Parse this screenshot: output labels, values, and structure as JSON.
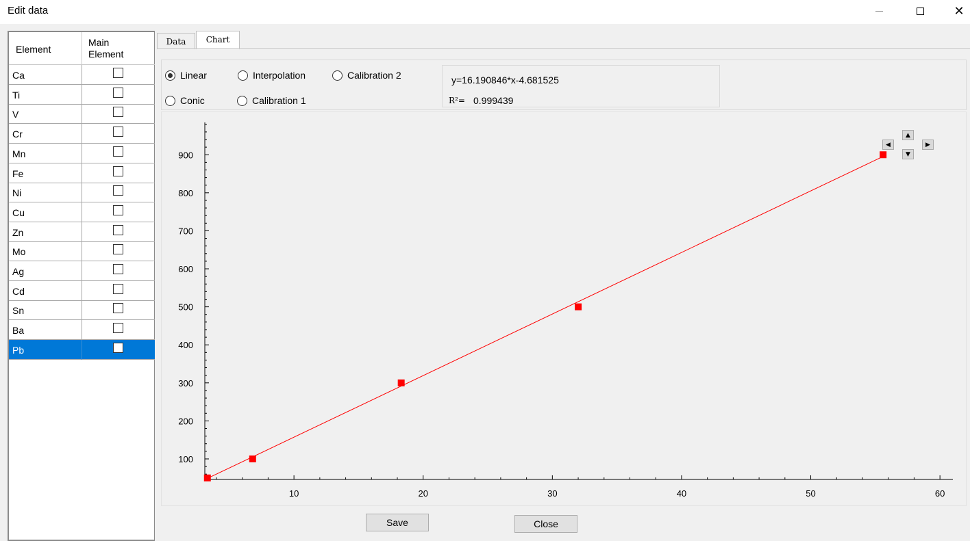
{
  "window": {
    "title": "Edit data"
  },
  "table": {
    "headers": {
      "element": "Element",
      "main_element_line1": "Main",
      "main_element_line2": "Element"
    },
    "rows": [
      {
        "name": "Ca",
        "checked": false
      },
      {
        "name": "Ti",
        "checked": false
      },
      {
        "name": "V",
        "checked": false
      },
      {
        "name": "Cr",
        "checked": false
      },
      {
        "name": "Mn",
        "checked": false
      },
      {
        "name": "Fe",
        "checked": false
      },
      {
        "name": "Ni",
        "checked": false
      },
      {
        "name": "Cu",
        "checked": false
      },
      {
        "name": "Zn",
        "checked": false
      },
      {
        "name": "Mo",
        "checked": false
      },
      {
        "name": "Ag",
        "checked": false
      },
      {
        "name": "Cd",
        "checked": false
      },
      {
        "name": "Sn",
        "checked": false
      },
      {
        "name": "Ba",
        "checked": false
      },
      {
        "name": "Pb",
        "checked": false,
        "selected": true
      }
    ]
  },
  "tabs": [
    {
      "label": "Data",
      "active": false
    },
    {
      "label": "Chart",
      "active": true
    }
  ],
  "fit_options": {
    "linear": "Linear",
    "interpolation": "Interpolation",
    "calibration2": "Calibration 2",
    "conic": "Conic",
    "calibration1": "Calibration 1",
    "selected": "linear"
  },
  "equation": {
    "formula": "y=16.190846*x-4.681525",
    "r2_label": "R²=",
    "r2_value": "0.999439"
  },
  "nav_icons": [
    "arrow-left-icon",
    "arrow-up-icon",
    "arrow-down-icon",
    "arrow-right-icon"
  ],
  "buttons": {
    "save": "Save",
    "close": "Close"
  },
  "colors": {
    "series": "#ff0000",
    "selection": "#0078d7"
  },
  "chart_data": {
    "type": "scatter",
    "x_ticks": [
      10,
      20,
      30,
      40,
      50,
      60
    ],
    "y_ticks": [
      100,
      200,
      300,
      400,
      500,
      600,
      700,
      800,
      900
    ],
    "xlim": [
      3.1,
      61
    ],
    "ylim": [
      46,
      985
    ],
    "points": [
      {
        "x": 3.3,
        "y": 50
      },
      {
        "x": 6.8,
        "y": 100
      },
      {
        "x": 18.3,
        "y": 300
      },
      {
        "x": 32.0,
        "y": 500
      },
      {
        "x": 55.6,
        "y": 900
      }
    ],
    "fit": {
      "slope": 16.190846,
      "intercept": -4.681525
    },
    "grid": false
  }
}
